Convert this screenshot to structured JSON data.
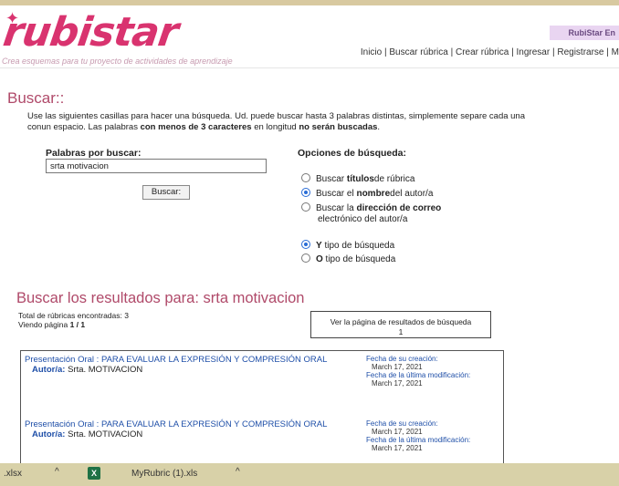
{
  "header": {
    "logo": "rubistar",
    "tagline": "Crea esquemas para tu proyecto de actividades de aprendizaje",
    "badge": "RubiStar En",
    "nav": {
      "inicio": "Inicio",
      "buscar": "Buscar rúbrica",
      "crear": "Crear rúbrica",
      "ingresar": "Ingresar",
      "registrarse": "Registrarse",
      "more": "M"
    }
  },
  "search": {
    "heading": "Buscar::",
    "intro_part1": "Use las siguientes casillas para hacer una búsqueda. Ud. puede buscar hasta 3 palabras distintas, simplemente separe cada una conun espacio. Las palabras ",
    "intro_bold1": "con menos de 3 caracteres",
    "intro_part2": " en longitud ",
    "intro_bold2": "no serán buscadas",
    "intro_part3": ".",
    "label": "Palabras por buscar:",
    "value": "srta motivacion",
    "button": "Buscar:"
  },
  "options": {
    "heading": "Opciones de búsqueda:",
    "titulos_pre": "Buscar ",
    "titulos_bold": "títulos",
    "titulos_post": "de rúbrica",
    "nombre_pre": "Buscar el ",
    "nombre_bold": "nombre",
    "nombre_post": "del autor/a",
    "correo_pre": "Buscar la ",
    "correo_bold": "dirección de correo",
    "correo_line2": "electrónico del autor/a",
    "y_bold": "Y",
    "y_post": " tipo de búsqueda",
    "o_bold": "O",
    "o_post": " tipo de búsqueda"
  },
  "results": {
    "heading": "Buscar los resultados para: srta motivacion",
    "total": "Total de rúbricas encontradas: 3",
    "page_label": "Viendo página ",
    "page_value": "1 / 1",
    "ver_link": "Ver la página de resultados de búsqueda",
    "ver_page": "1",
    "items": [
      {
        "title": "Presentación Oral : PARA EVALUAR LA EXPRESIÓN Y COMPRESIÓN ORAL",
        "author_label": "Autor/a:",
        "author": "Srta. MOTIVACION",
        "created_label": "Fecha de su creación:",
        "created": "March 17, 2021",
        "modified_label": "Fecha de la última modificación:",
        "modified": "March 17, 2021"
      },
      {
        "title": "Presentación Oral : PARA EVALUAR LA EXPRESIÓN Y COMPRESIÓN ORAL",
        "author_label": "Autor/a:",
        "author": "Srta. MOTIVACION",
        "created_label": "Fecha de su creación:",
        "created": "March 17, 2021",
        "modified_label": "Fecha de la última modificación:",
        "modified": "March 17, 2021"
      }
    ]
  },
  "taskbar": {
    "file1": ".xlsx",
    "file2": "MyRubric (1).xls",
    "chevron": "^"
  }
}
